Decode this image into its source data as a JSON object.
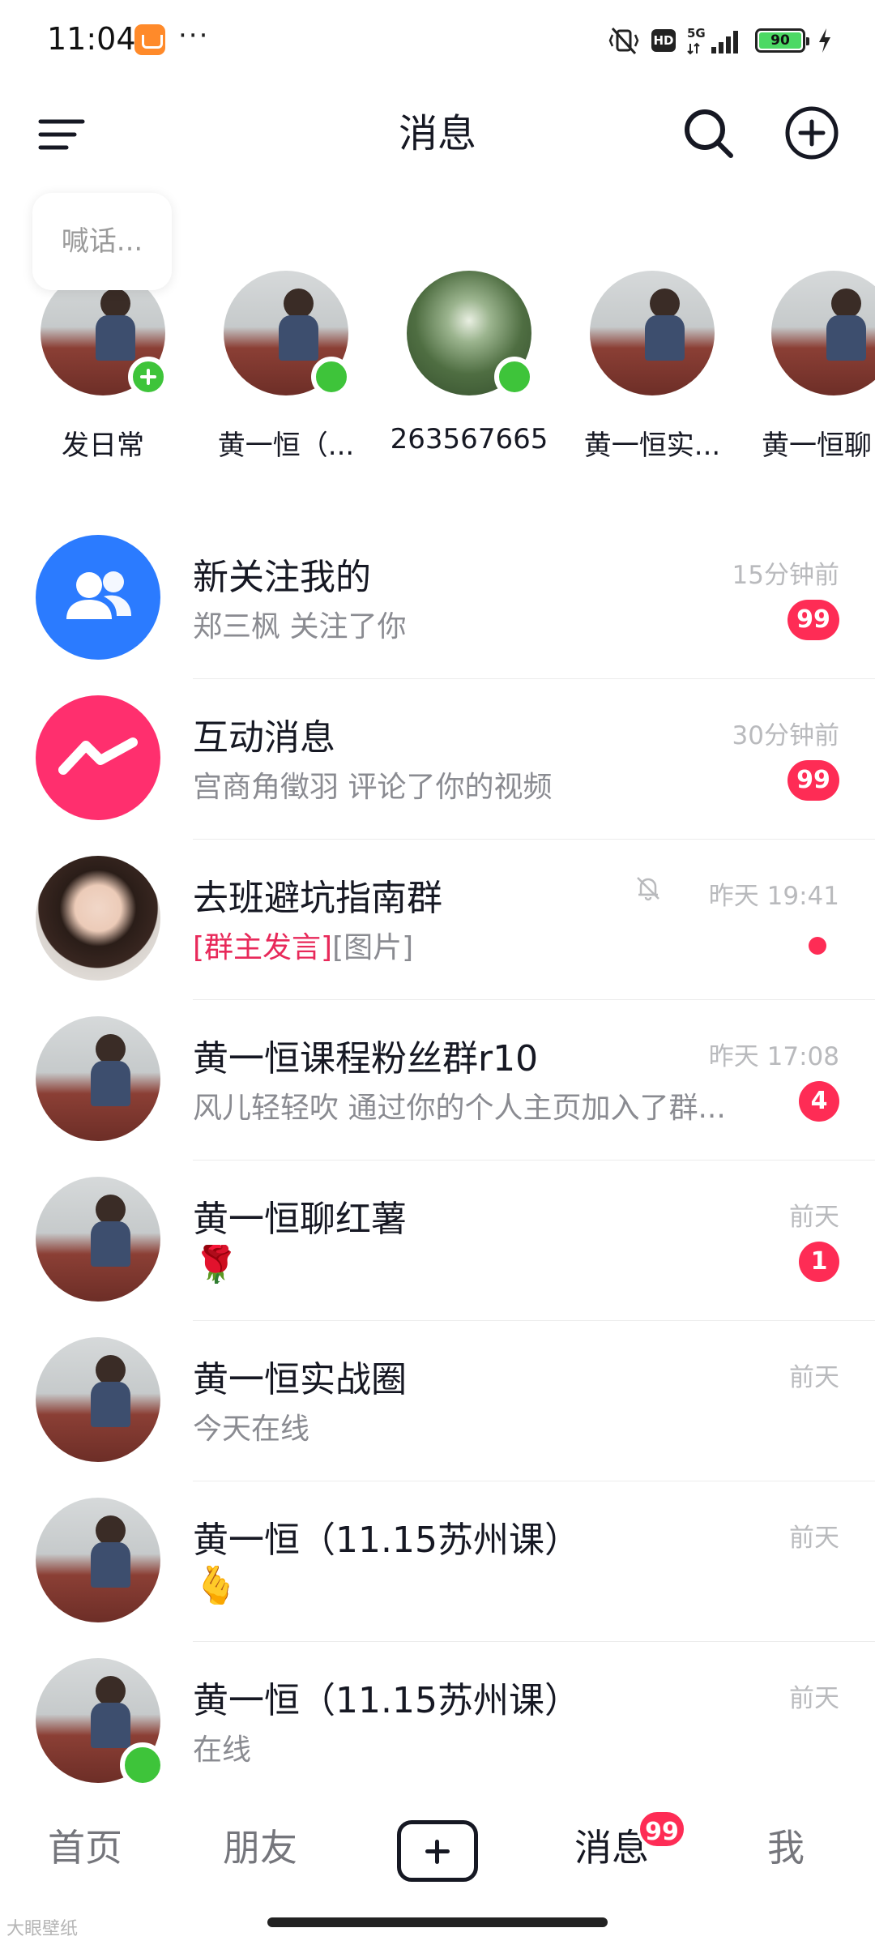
{
  "status_bar": {
    "time": "11:04",
    "more": "···",
    "hd": "HD",
    "network": "5G",
    "battery": "90"
  },
  "header": {
    "title": "消息"
  },
  "shout": {
    "placeholder": "喊话..."
  },
  "stories": [
    {
      "name": "发日常"
    },
    {
      "name": "黄一恒（..."
    },
    {
      "name": "263567665"
    },
    {
      "name": "黄一恒实..."
    },
    {
      "name": "黄一恒聊"
    }
  ],
  "chats": [
    {
      "name": "新关注我的",
      "time": "15分钟前",
      "preview": "郑三枫 关注了你",
      "badge": "99"
    },
    {
      "name": "互动消息",
      "time": "30分钟前",
      "preview": "宫商角徵羽 评论了你的视频",
      "badge": "99"
    },
    {
      "name": "去班避坑指南群",
      "time": "昨天 19:41",
      "preview_highlight": "[群主发言]",
      "preview": "[图片]"
    },
    {
      "name": "黄一恒课程粉丝群r10",
      "time": "昨天 17:08",
      "preview": "风儿轻轻吹 通过你的个人主页加入了群...",
      "badge": "4"
    },
    {
      "name": "黄一恒聊红薯",
      "time": "前天",
      "preview": "🌹",
      "badge": "1"
    },
    {
      "name": "黄一恒实战圈",
      "time": "前天",
      "preview": "今天在线"
    },
    {
      "name": "黄一恒（11.15苏州课）",
      "time": "前天",
      "preview": "🫰"
    },
    {
      "name": "黄一恒（11.15苏州课）",
      "time": "前天",
      "preview": "在线"
    }
  ],
  "bottom_nav": {
    "home": "首页",
    "friends": "朋友",
    "messages": "消息",
    "messages_badge": "99",
    "me": "我"
  },
  "watermark": "大眼壁纸",
  "colors": {
    "accent": "#fe2c55",
    "online": "#3ec43a",
    "fans_icon_bg": "#2b7bff",
    "interact_icon_bg": "#ff2f6e"
  }
}
